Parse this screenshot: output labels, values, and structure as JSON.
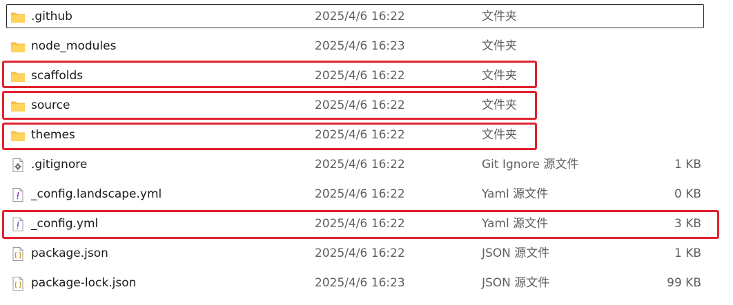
{
  "colors": {
    "folder": "#f3c243",
    "highlight": "#e0222e",
    "selection_border": "#2a2a2a",
    "text_secondary": "#5f5f5f"
  },
  "files": [
    {
      "name": ".github",
      "date": "2025/4/6 16:22",
      "type": "文件夹",
      "size": "",
      "icon": "folder-icon"
    },
    {
      "name": "node_modules",
      "date": "2025/4/6 16:23",
      "type": "文件夹",
      "size": "",
      "icon": "folder-icon"
    },
    {
      "name": "scaffolds",
      "date": "2025/4/6 16:22",
      "type": "文件夹",
      "size": "",
      "icon": "folder-icon"
    },
    {
      "name": "source",
      "date": "2025/4/6 16:22",
      "type": "文件夹",
      "size": "",
      "icon": "folder-icon"
    },
    {
      "name": "themes",
      "date": "2025/4/6 16:22",
      "type": "文件夹",
      "size": "",
      "icon": "folder-icon"
    },
    {
      "name": ".gitignore",
      "date": "2025/4/6 16:22",
      "type": "Git Ignore 源文件",
      "size": "1 KB",
      "icon": "gear-file-icon"
    },
    {
      "name": "_config.landscape.yml",
      "date": "2025/4/6 16:22",
      "type": "Yaml 源文件",
      "size": "0 KB",
      "icon": "yaml-file-icon"
    },
    {
      "name": "_config.yml",
      "date": "2025/4/6 16:22",
      "type": "Yaml 源文件",
      "size": "3 KB",
      "icon": "yaml-file-icon"
    },
    {
      "name": "package.json",
      "date": "2025/4/6 16:22",
      "type": "JSON 源文件",
      "size": "1 KB",
      "icon": "json-file-icon"
    },
    {
      "name": "package-lock.json",
      "date": "2025/4/6 16:23",
      "type": "JSON 源文件",
      "size": "99 KB",
      "icon": "json-file-icon"
    }
  ]
}
